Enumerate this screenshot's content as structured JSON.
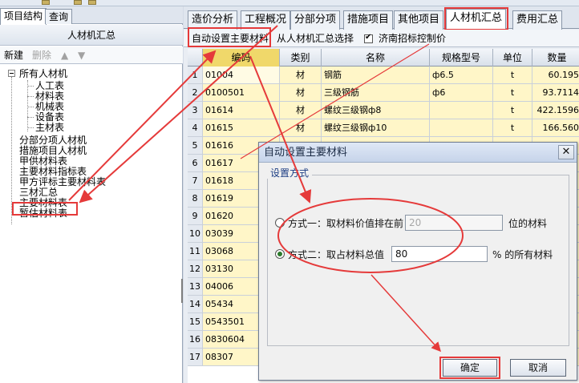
{
  "left": {
    "tabs": [
      {
        "label": "项目结构"
      },
      {
        "label": "查询"
      }
    ],
    "title": "人材机汇总",
    "toolbar": {
      "new": "新建",
      "delete": "删除",
      "up_arrow": "▲",
      "down_arrow": "▼"
    },
    "tree": {
      "root": "所有人材机",
      "children": [
        "人工表",
        "材料表",
        "机械表",
        "设备表",
        "主材表"
      ],
      "items": [
        "分部分项人材机",
        "措施项目人材机",
        "甲供材料表",
        "主要材料指标表",
        "甲方评标主要材料表",
        "三材汇总",
        "主要材料表",
        "暂估材料表"
      ]
    }
  },
  "main": {
    "tabs": [
      {
        "label": "造价分析"
      },
      {
        "label": "工程概况"
      },
      {
        "label": "分部分项"
      },
      {
        "label": "措施项目"
      },
      {
        "label": "其他项目"
      },
      {
        "label": "人材机汇总"
      },
      {
        "label": "费用汇总"
      }
    ],
    "toolbar": {
      "auto_set": "自动设置主要材料",
      "select_from": "从人材机汇总选择",
      "jinan_label": "济南招标控制价"
    },
    "grid": {
      "headers": [
        "编码",
        "类别",
        "名称",
        "规格型号",
        "单位",
        "数量"
      ],
      "rows": [
        {
          "idx": "1",
          "code": "01004",
          "cat": "材",
          "name": "钢筋",
          "spec": "ф6.5",
          "unit": "t",
          "qty": "60.195"
        },
        {
          "idx": "2",
          "code": "0100501",
          "cat": "材",
          "name": "三级钢筋",
          "spec": "ф6",
          "unit": "t",
          "qty": "93.7114"
        },
        {
          "idx": "3",
          "code": "01614",
          "cat": "材",
          "name": "螺纹三级钢ф8",
          "spec": "",
          "unit": "t",
          "qty": "422.1596"
        },
        {
          "idx": "4",
          "code": "01615",
          "cat": "材",
          "name": "螺纹三级钢ф10",
          "spec": "",
          "unit": "t",
          "qty": "166.560"
        },
        {
          "idx": "5",
          "code": "01616"
        },
        {
          "idx": "6",
          "code": "01617"
        },
        {
          "idx": "7",
          "code": "01618"
        },
        {
          "idx": "8",
          "code": "01619"
        },
        {
          "idx": "9",
          "code": "01620"
        },
        {
          "idx": "10",
          "code": "03039"
        },
        {
          "idx": "11",
          "code": "03068"
        },
        {
          "idx": "12",
          "code": "03130"
        },
        {
          "idx": "13",
          "code": "04006"
        },
        {
          "idx": "14",
          "code": "05434"
        },
        {
          "idx": "15",
          "code": "0543501"
        },
        {
          "idx": "16",
          "code": "0830604"
        },
        {
          "idx": "17",
          "code": "08307"
        }
      ]
    }
  },
  "dialog": {
    "title": "自动设置主要材料",
    "close": "✕",
    "group": "设置方式",
    "option1": {
      "label": "方式一：取材料价值排在前",
      "value": "20",
      "suffix": "位的材料",
      "checked": false
    },
    "option2": {
      "label": "方式二：取占材料总值",
      "value": "80",
      "suffix": "% 的所有材料",
      "checked": true
    },
    "ok": "确定",
    "cancel": "取消"
  },
  "colors": {
    "annotation": "#e53a3a",
    "cell_yellow": "#fff6c8",
    "header_selected": "#f0d86a",
    "legend_blue": "#1c3d83"
  }
}
